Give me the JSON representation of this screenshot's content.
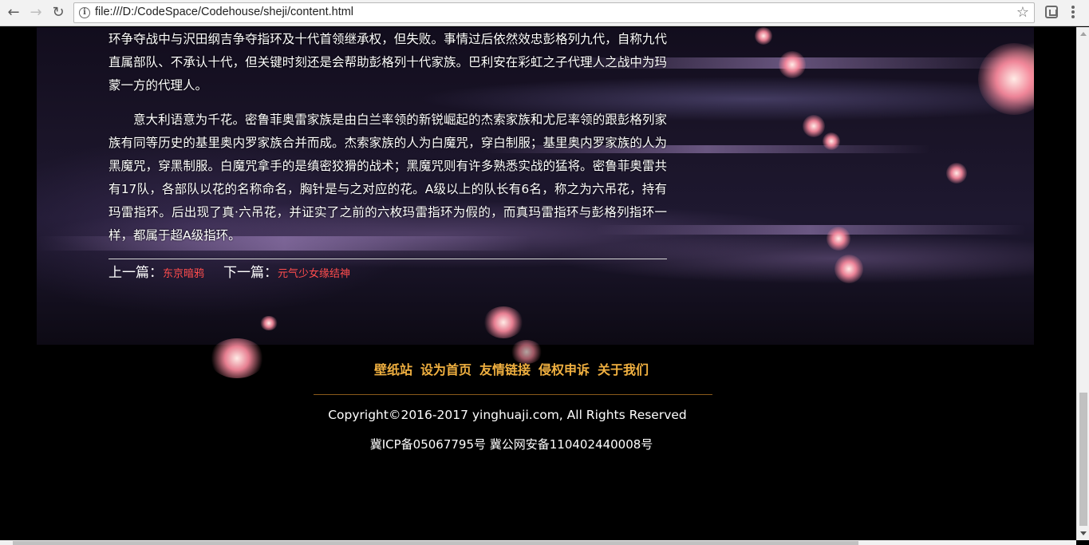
{
  "browser": {
    "back_glyph": "←",
    "forward_glyph": "→",
    "reload_glyph": "↻",
    "url": "file:///D:/CodeSpace/Codehouse/sheji/content.html",
    "info_glyph": "i",
    "bookmark_glyph": "☆",
    "icons": [
      "back-icon",
      "forward-icon",
      "reload-icon",
      "info-icon",
      "bookmark-star-icon",
      "extension-icon",
      "menu-icon"
    ]
  },
  "article": {
    "paragraphs": [
      "环争夺战中与沢田纲吉争夺指环及十代首领继承权，但失败。事情过后依然效忠彭格列九代，自称九代直属部队、不承认十代，但关键时刻还是会帮助彭格列十代家族。巴利安在彩虹之子代理人之战中为玛蒙一方的代理人。",
      "意大利语意为千花。密鲁菲奥雷家族是由白兰率领的新锐崛起的杰索家族和尤尼率领的跟彭格列家族有同等历史的基里奥内罗家族合并而成。杰索家族的人为白魔咒，穿白制服；基里奥内罗家族的人为黑魔咒，穿黑制服。白魔咒拿手的是缜密狡猾的战术；黑魔咒则有许多熟悉实战的猛将。密鲁菲奥雷共有17队，各部队以花的名称命名，胸针是与之对应的花。A级以上的队长有6名，称之为六吊花，持有玛雷指环。后出现了真·六吊花，并证实了之前的六枚玛雷指环为假的，而真玛雷指环与彭格列指环一样，都属于超A级指环。"
    ],
    "pager": {
      "prev_label": "上一篇：",
      "prev_title": "东京暗鸦",
      "next_label": "下一篇：",
      "next_title": "元气少女缘结神"
    }
  },
  "footer": {
    "links": [
      "壁纸站",
      "设为首页",
      "友情链接",
      "侵权申诉",
      "关于我们"
    ],
    "copyright": "Copyright©2016-2017 yinghuaji.com, All Rights Reserved",
    "icp": "冀ICP备05067795号 冀公网安备110402440008号"
  },
  "colors": {
    "footer_link": "#f0b040",
    "pager_link": "#ff4d4d",
    "footer_rule": "#8a5a1a"
  }
}
